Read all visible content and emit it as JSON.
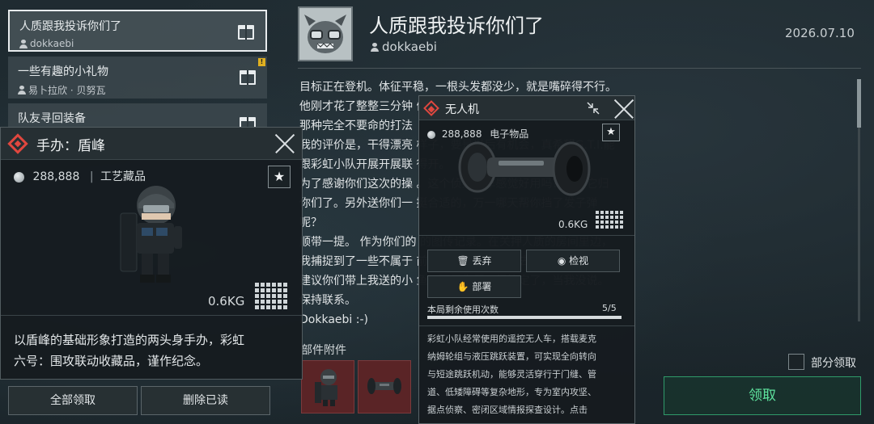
{
  "mail_list": {
    "items": [
      {
        "title": "人质跟我投诉你们了",
        "sender": "dokkaebi",
        "unread": false
      },
      {
        "title": "一些有趣的小礼物",
        "sender": "易卜拉欣 · 贝努瓦",
        "unread": true,
        "badge": "!"
      },
      {
        "title": "队友寻回装备",
        "sender": "",
        "unread": false
      }
    ],
    "claim_all_label": "全部领取",
    "delete_read_label": "删除已读"
  },
  "mail": {
    "title": "人质跟我投诉你们了",
    "sender": "dokkaebi",
    "date": "2026.07.10",
    "body_lines": [
      "目标正在登机。体征平稳，一根头发都没少，就是嘴碎得不行。",
      "他刚才花了整整三分钟                                      们的人总是“咻”一下“嘭”一下的，",
      "那种完全不要命的打法",
      "我的评价是，干得漂亮                                      样子，要是以后有机会，真希望G.T.I.能",
      "跟彩虹小队开展开展联                                      得开。",
      "为了感谢你们这次的操                                      。这个侦察小车感觉好用吗？现在它归",
      "你们了。另外送你们一                                      挺合适的，万一哪天帮你挡了发子弹",
      "呢？",
      "顺带一提。 作为你们的                                      的图传记录。在关押人质的房间里边，",
      "我捕捉到了一些不属于                                      前，也许有“其他人”去过那里。",
      "建议你们带上我送的小                                      鱼。要是你们已经搞定了，当我没说。",
      "保持联系。",
      "Dokkaebi :-)"
    ],
    "attachments_label": "部件附件",
    "partial_claim_label": "部分领取",
    "claim_label": "领取"
  },
  "figure_popup": {
    "title": "手办：盾峰",
    "price": "288,888",
    "category": "工艺藏品",
    "weight": "0.6KG",
    "description_lines": [
      "以盾峰的基础形象打造的两头身手办，彩虹",
      "六号：围攻联动收藏品，谨作纪念。"
    ]
  },
  "drone_popup": {
    "title": "无人机",
    "price": "288,888",
    "category": "电子物品",
    "weight": "0.6KG",
    "discard_label": "丢弃",
    "inspect_label": "检视",
    "deploy_label": "部署",
    "uses_label": "本局剩余使用次数",
    "uses_value": "5/5",
    "uses_fraction": 1.0,
    "description_lines": [
      "彩虹小队经常使用的遥控无人车，搭载麦克",
      "纳姆轮组与液压跳跃装置，可实现全向转向",
      "与短途跳跃机动，能够灵活穿行于门缝、管",
      "道、低矮障碍等复杂地形，专为室内攻坚、",
      "据点侦察、密闭区域情报探查设计。点击"
    ]
  },
  "colors": {
    "accent_red": "#e0473f",
    "claim_green": "#5ee39e",
    "badge_yellow": "#e0b020"
  }
}
